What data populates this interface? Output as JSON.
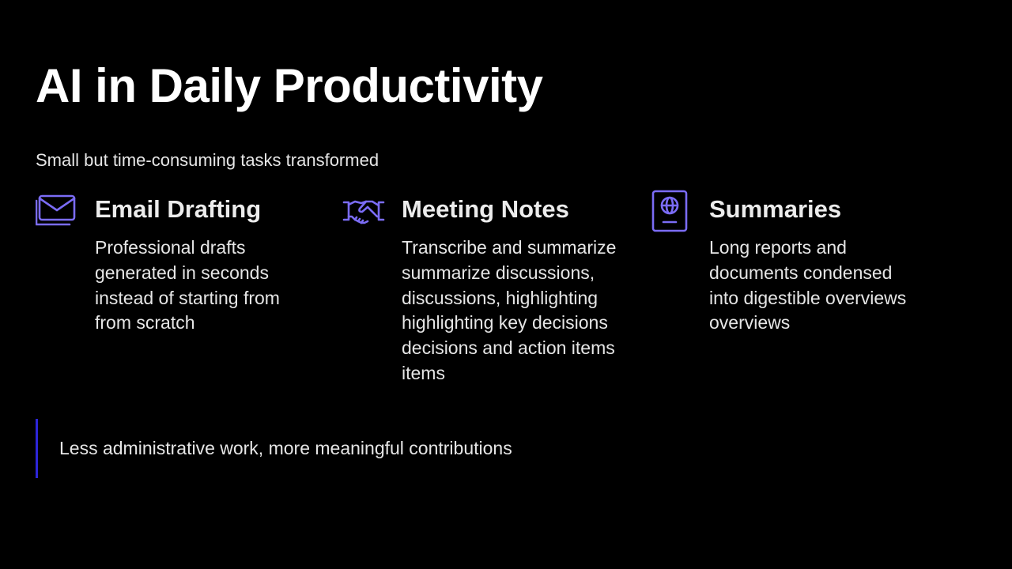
{
  "slide": {
    "title": "AI in Daily Productivity",
    "subtitle": "Small but time-consuming tasks transformed",
    "accent_color": "#7b6cf6",
    "callout_bar_color": "#2d26d8",
    "cards": [
      {
        "icon": "envelope-icon",
        "title": "Email Drafting",
        "body": "Professional drafts\ngenerated in seconds\ninstead of starting from\nfrom scratch"
      },
      {
        "icon": "handshake-icon",
        "title": "Meeting Notes",
        "body": "Transcribe and summarize\nsummarize discussions,\ndiscussions, highlighting\nhighlighting key decisions\ndecisions and action items\nitems"
      },
      {
        "icon": "passport-icon",
        "title": "Summaries",
        "body": "Long reports and\ndocuments condensed\ninto digestible overviews\noverviews"
      }
    ],
    "callout": "Less administrative work, more meaningful contributions"
  }
}
